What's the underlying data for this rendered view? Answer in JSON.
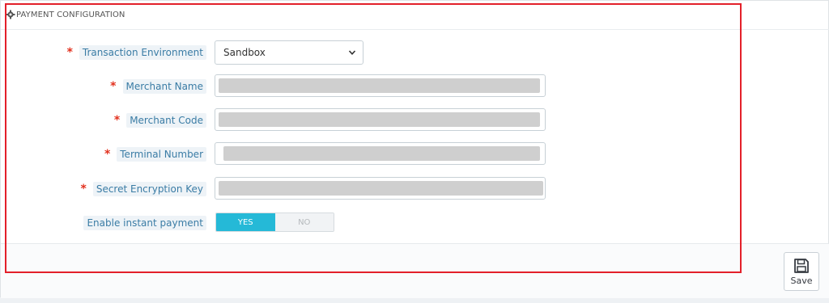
{
  "panel": {
    "title": "PAYMENT CONFIGURATION",
    "icon": "gear-icon"
  },
  "fields": {
    "environment": {
      "label": "Transaction Environment",
      "value": "Sandbox",
      "required": "*"
    },
    "merchant_name": {
      "label": "Merchant Name",
      "required": "*"
    },
    "merchant_code": {
      "label": "Merchant Code",
      "required": "*"
    },
    "terminal_number": {
      "label": "Terminal Number",
      "required": "*"
    },
    "secret_key": {
      "label": "Secret Encryption Key",
      "required": "*"
    },
    "instant_payment": {
      "label": "Enable instant payment",
      "yes": "YES",
      "no": "NO",
      "selected": "YES"
    }
  },
  "footer": {
    "save_label": "Save",
    "save_icon": "floppy-disk-icon"
  },
  "colors": {
    "accent": "#25b9d7",
    "required": "#e2301d",
    "label_text": "#3a7ca5",
    "highlight": "#e3202a"
  }
}
